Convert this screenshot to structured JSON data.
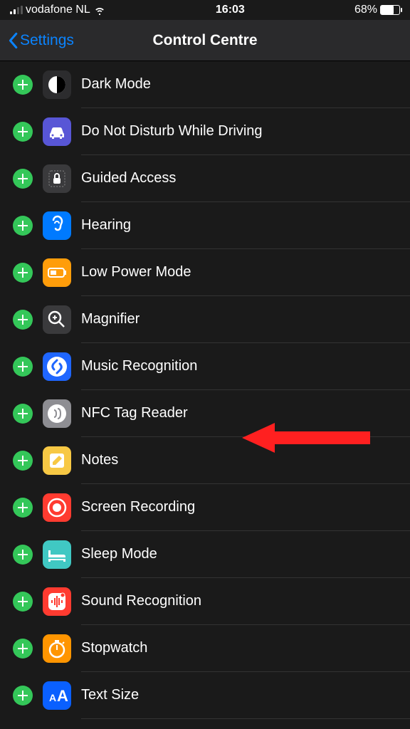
{
  "status": {
    "carrier": "vodafone NL",
    "time": "16:03",
    "battery_pct": "68%"
  },
  "header": {
    "back_label": "Settings",
    "title": "Control Centre"
  },
  "items": [
    {
      "label": "Dark Mode",
      "icon": "dark-mode-icon",
      "bg": "ic-dark"
    },
    {
      "label": "Do Not Disturb While Driving",
      "icon": "car-icon",
      "bg": "ic-dnd"
    },
    {
      "label": "Guided Access",
      "icon": "lock-icon",
      "bg": "ic-guided"
    },
    {
      "label": "Hearing",
      "icon": "ear-icon",
      "bg": "ic-hearing"
    },
    {
      "label": "Low Power Mode",
      "icon": "battery-icon",
      "bg": "ic-lowpower"
    },
    {
      "label": "Magnifier",
      "icon": "magnifier-icon",
      "bg": "ic-magnifier"
    },
    {
      "label": "Music Recognition",
      "icon": "shazam-icon",
      "bg": "ic-music"
    },
    {
      "label": "NFC Tag Reader",
      "icon": "nfc-icon",
      "bg": "ic-nfc",
      "highlight": true
    },
    {
      "label": "Notes",
      "icon": "notes-icon",
      "bg": "ic-notes"
    },
    {
      "label": "Screen Recording",
      "icon": "record-icon",
      "bg": "ic-screenrec"
    },
    {
      "label": "Sleep Mode",
      "icon": "bed-icon",
      "bg": "ic-sleep"
    },
    {
      "label": "Sound Recognition",
      "icon": "wave-icon",
      "bg": "ic-soundrec"
    },
    {
      "label": "Stopwatch",
      "icon": "stopwatch-icon",
      "bg": "ic-stopwatch"
    },
    {
      "label": "Text Size",
      "icon": "textsize-icon",
      "bg": "ic-textsize"
    }
  ]
}
